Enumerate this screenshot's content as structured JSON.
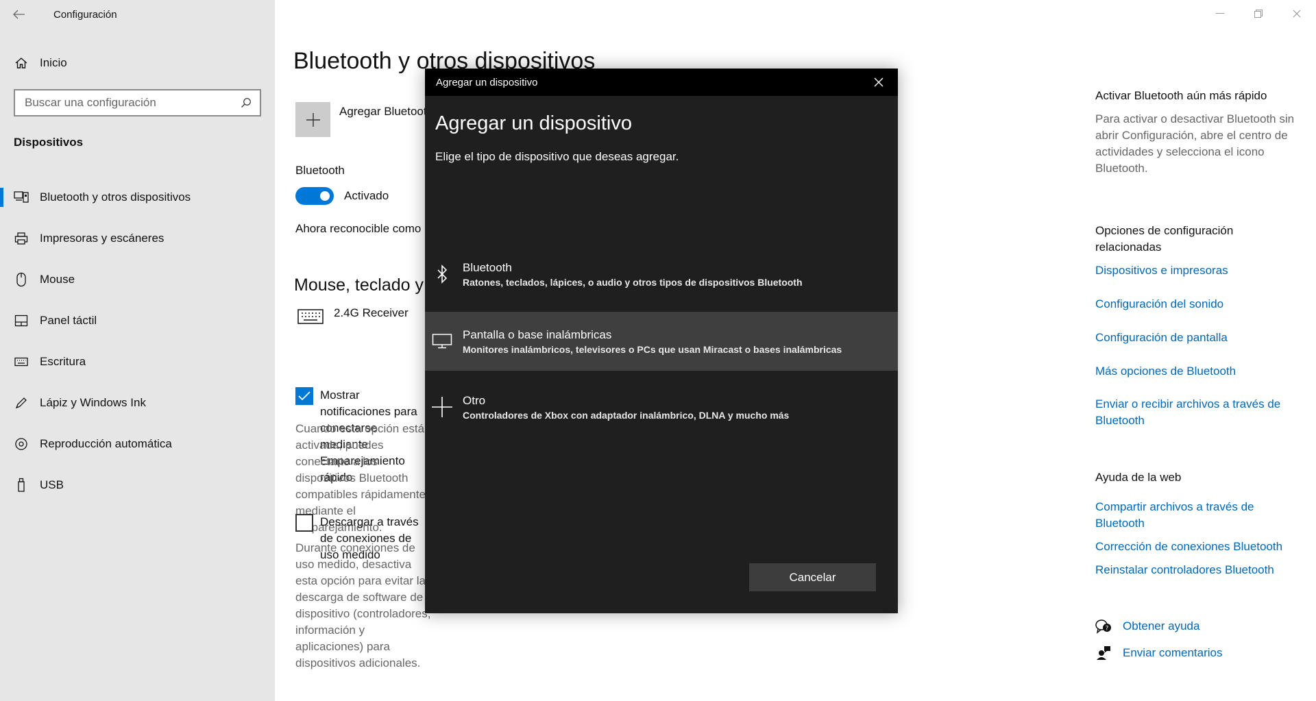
{
  "window": {
    "title": "Configuración"
  },
  "sidebar": {
    "home_label": "Inicio",
    "search_placeholder": "Buscar una configuración",
    "section_title": "Dispositivos",
    "items": [
      {
        "label": "Bluetooth y otros dispositivos",
        "icon": "bluetooth-devices-icon",
        "active": true
      },
      {
        "label": "Impresoras y escáneres",
        "icon": "printer-icon"
      },
      {
        "label": "Mouse",
        "icon": "mouse-icon"
      },
      {
        "label": "Panel táctil",
        "icon": "touchpad-icon"
      },
      {
        "label": "Escritura",
        "icon": "keyboard-icon"
      },
      {
        "label": "Lápiz y Windows Ink",
        "icon": "pen-icon"
      },
      {
        "label": "Reproducción automática",
        "icon": "autoplay-icon"
      },
      {
        "label": "USB",
        "icon": "usb-icon"
      }
    ]
  },
  "main": {
    "page_title": "Bluetooth y otros dispositivos",
    "add_label": "Agregar Bluetooth u otro dispositivo",
    "bluetooth_label": "Bluetooth",
    "toggle_state": "Activado",
    "discoverable_text": "Ahora reconocible como",
    "section_heading": "Mouse, teclado y lápiz",
    "device_name": "2.4G Receiver",
    "notifications_label": "Mostrar notificaciones para conectarse mediante Emparejamiento rápido",
    "notifications_desc": "Cuando esta opción está activada, puedes conectarte a los dispositivos Bluetooth compatibles rápidamente mediante el emparejamiento.",
    "download_label": "Descargar a través de conexiones de uso medido",
    "download_desc": "Durante conexiones de uso medido, desactiva esta opción para evitar la descarga de software de dispositivo (controladores, información y aplicaciones) para dispositivos adicionales."
  },
  "right_panel": {
    "quick_heading": "Activar Bluetooth aún más rápido",
    "quick_text": "Para activar o desactivar Bluetooth sin abrir Configuración, abre el centro de actividades y selecciona el icono Bluetooth.",
    "related_heading": "Opciones de configuración relacionadas",
    "related_links": [
      "Dispositivos e impresoras",
      "Configuración del sonido",
      "Configuración de pantalla",
      "Más opciones de Bluetooth",
      "Enviar o recibir archivos a través de Bluetooth"
    ],
    "web_heading": "Ayuda de la web",
    "web_links": [
      "Compartir archivos a través de Bluetooth",
      "Corrección de conexiones Bluetooth",
      "Reinstalar controladores Bluetooth"
    ],
    "get_help": "Obtener ayuda",
    "feedback": "Enviar comentarios"
  },
  "dialog": {
    "window_title": "Agregar un dispositivo",
    "heading": "Agregar un dispositivo",
    "subtitle": "Elige el tipo de dispositivo que deseas agregar.",
    "options": [
      {
        "name": "Bluetooth",
        "detail": "Ratones, teclados, lápices, o audio y otros tipos de dispositivos Bluetooth",
        "icon": "bluetooth-icon"
      },
      {
        "name": "Pantalla o base inalámbricas",
        "detail": "Monitores inalámbricos, televisores o PCs que usan Miracast o bases inalámbricas",
        "icon": "monitor-icon"
      },
      {
        "name": "Otro",
        "detail": "Controladores de Xbox con adaptador inalámbrico, DLNA y mucho más",
        "icon": "plus-icon"
      }
    ],
    "cancel_label": "Cancelar"
  },
  "colors": {
    "accent": "#0078d7",
    "link": "#0067b8",
    "dialog_bg": "#1f1f1f",
    "sidebar_bg": "#e6e6e6"
  }
}
